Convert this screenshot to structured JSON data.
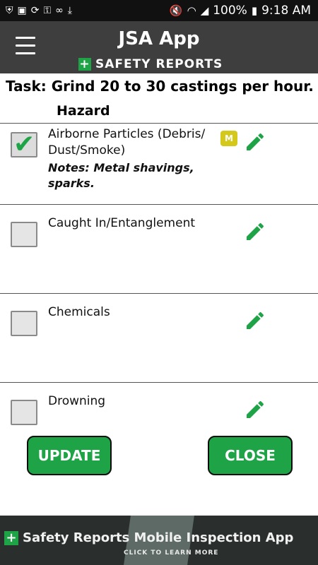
{
  "status_bar": {
    "battery": "100%",
    "time": "9:18 AM",
    "left_icons": [
      "shield-wifi-icon",
      "sd-card-icon",
      "sync-icon",
      "lock-wifi-icon",
      "voicemail-icon",
      "download-icon"
    ],
    "right_icons": [
      "mute-icon",
      "wifi-icon",
      "signal-icon",
      "battery-icon"
    ]
  },
  "header": {
    "title": "JSA App",
    "brand": "SAFETY REPORTS",
    "menu_icon": "hamburger-menu-icon",
    "colors": {
      "header_bg": "#3e3e3e",
      "accent": "#1ea446"
    }
  },
  "task": "Task: Grind 20 to 30 castings per hour.",
  "hazard_heading": "Hazard",
  "hazards": [
    {
      "name": "Airborne Particles (Debris/ Dust/Smoke)",
      "notes": "Notes: Metal shavings, sparks.",
      "checked": true,
      "badge": "M"
    },
    {
      "name": "Caught In/Entanglement",
      "notes": "",
      "checked": false,
      "badge": ""
    },
    {
      "name": "Chemicals",
      "notes": "",
      "checked": false,
      "badge": ""
    },
    {
      "name": "Drowning",
      "notes": "",
      "checked": false,
      "badge": ""
    }
  ],
  "buttons": {
    "update": "UPDATE",
    "close": "CLOSE"
  },
  "ad": {
    "title": "Safety Reports Mobile Inspection App",
    "cta": "CLICK TO LEARN MORE"
  }
}
